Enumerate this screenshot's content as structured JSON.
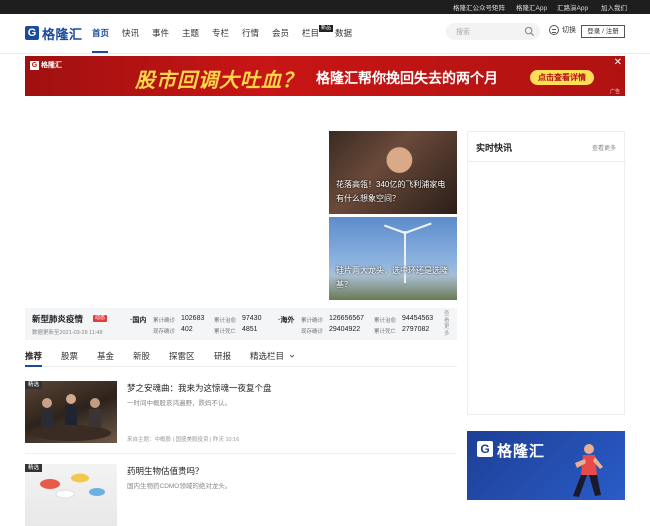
{
  "topbar": {
    "links": [
      "格隆汇公众号矩阵",
      "格隆汇App",
      "汇路演App",
      "加入我们"
    ]
  },
  "nav": {
    "logo_text": "格隆汇",
    "items": [
      "首页",
      "快讯",
      "事件",
      "主题",
      "专栏",
      "行情",
      "会员",
      "栏目",
      "数据"
    ],
    "active": "首页",
    "badge": "新品",
    "search_placeholder": "搜索",
    "switch_label": "切换",
    "login_label": "登录 / 注册"
  },
  "banner": {
    "logo": "格隆汇",
    "headline": "股市回调大吐血？",
    "subline": "格隆汇帮你挽回失去的两个月",
    "cta": "点击查看详情",
    "close": "✕",
    "ad_tag": "广告"
  },
  "featured": [
    {
      "caption": "花落高瓴！340亿的飞利浦家电有什么想象空间？"
    },
    {
      "caption": "硅片两大龙头，选中环还是选隆基？"
    }
  ],
  "realtime": {
    "title": "实时快讯",
    "more": "查看更多"
  },
  "covid": {
    "title": "新型肺炎疫情",
    "tag": "动态",
    "updated": "数据更新至2021-03-28 11:48",
    "domestic": {
      "region": "·国内",
      "confirmed_label": "累计确诊",
      "confirmed": "102683",
      "cured_label": "累计治愈",
      "cured": "97430",
      "current_label": "现存确诊",
      "current": "402",
      "deaths_label": "累计死亡",
      "deaths": "4851"
    },
    "overseas": {
      "region": "·海外",
      "confirmed_label": "累计确诊",
      "confirmed": "126656567",
      "cured_label": "累计治愈",
      "cured": "94454563",
      "current_label": "现存确诊",
      "current": "29404922",
      "deaths_label": "累计死亡",
      "deaths": "2797082"
    },
    "more": "查看更多"
  },
  "tabs": [
    "推荐",
    "股票",
    "基金",
    "新股",
    "探雷区",
    "研报",
    "精选栏目"
  ],
  "articles": [
    {
      "tag": "精选",
      "title": "梦之安魂曲：我来为这惊魂一夜复个盘",
      "desc": "一时间中概股哀鸿遍野，跌妈不认。",
      "meta": "来自主题：中概股 | 国盛美股投资 | 昨天 10:16"
    },
    {
      "tag": "精选",
      "title": "药明生物估值贵吗？",
      "desc": "国内生物药CDMO领域的绝对龙头。",
      "meta": ""
    }
  ],
  "ad2": {
    "logo": "格隆汇"
  },
  "colors": {
    "brand": "#1a4b9c",
    "banner_red": "#c81515",
    "banner_yellow": "#ffd84a"
  }
}
